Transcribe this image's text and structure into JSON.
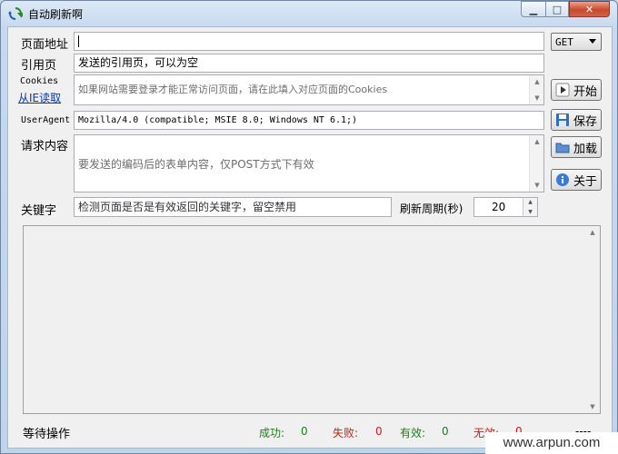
{
  "window": {
    "title": "自动刷新啊",
    "minimize_glyph": "▁",
    "maximize_glyph": "□",
    "close_glyph": "✕"
  },
  "form": {
    "url": {
      "label": "页面地址",
      "value": ""
    },
    "method": {
      "selected": "GET"
    },
    "referer": {
      "label": "引用页",
      "value": "发送的引用页，可以为空"
    },
    "cookies": {
      "label": "Cookies",
      "link_label": "从IE读取",
      "value": "如果网站需要登录才能正常访问页面，请在此填入对应页面的Cookies"
    },
    "user_agent": {
      "label": "UserAgent",
      "value": "Mozilla/4.0 (compatible; MSIE 8.0; Windows NT 6.1;)"
    },
    "body": {
      "label": "请求内容",
      "value": "要发送的编码后的表单内容，仅POST方式下有效"
    },
    "keyword": {
      "label": "关键字",
      "value": "检测页面是否是有效返回的关键字，留空禁用"
    },
    "refresh": {
      "label": "刷新周期(秒)",
      "value": "20"
    }
  },
  "buttons": {
    "start": "开始",
    "save": "保存",
    "load": "加载",
    "about": "关于"
  },
  "icons": {
    "app": "refresh-arrows-icon",
    "start": "play-icon",
    "save": "floppy-disk-icon",
    "load": "folder-icon",
    "about": "info-icon"
  },
  "status": {
    "state": "等待操作",
    "success_label": "成功:",
    "success_value": "0",
    "fail_label": "失败:",
    "fail_value": "0",
    "valid_label": "有效:",
    "valid_value": "0",
    "invalid_label": "无效:",
    "invalid_value": "0",
    "extra": "----"
  },
  "colors": {
    "success": "#1e7b1e",
    "fail": "#c0201a",
    "valid": "#1e7b1e",
    "invalid": "#c0201a"
  },
  "watermark": "www.arpun.com"
}
